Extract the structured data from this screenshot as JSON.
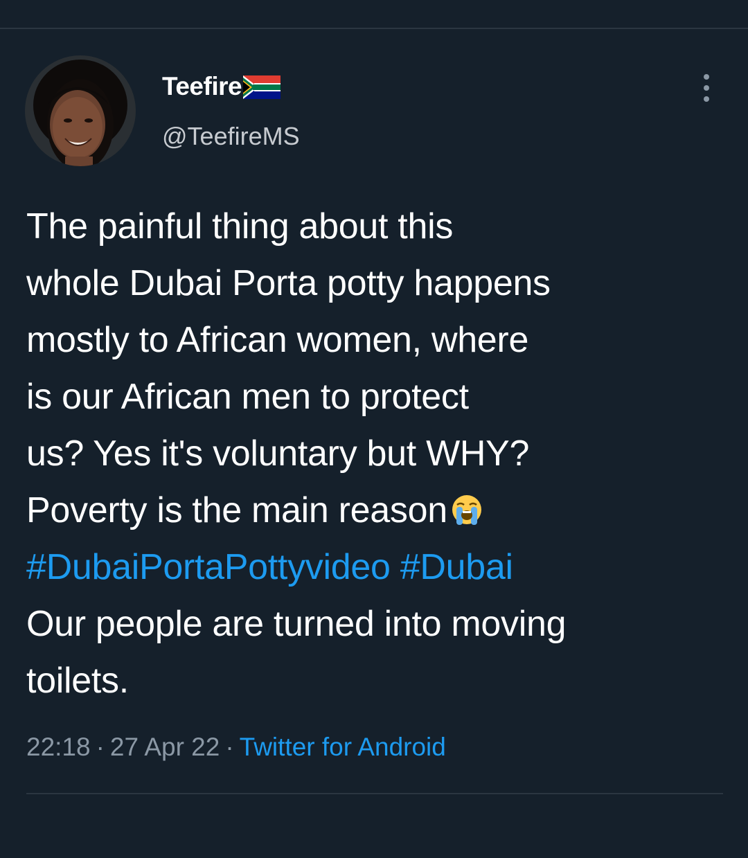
{
  "author": {
    "display_name": "Teefire",
    "handle": "@TeefireMS",
    "flag_icon": "south-africa-flag-icon",
    "avatar_icon": "user-avatar"
  },
  "tweet": {
    "lines": [
      "The painful thing about this",
      "whole Dubai Porta potty happens",
      "mostly to African women,  where",
      "is our African men to protect",
      "us? Yes it's voluntary but WHY?",
      "Poverty is the main reason"
    ],
    "emoji": "loudly-crying-face-icon",
    "hashtags": [
      "#DubaiPortaPottyvideo",
      "#Dubai"
    ],
    "after_hashtags_lines": [
      "Our people are turned into moving",
      "toilets."
    ]
  },
  "meta": {
    "time": "22:18",
    "separator": "·",
    "date": "27 Apr 22",
    "source": "Twitter for Android"
  },
  "menu": {
    "icon": "more-vertical-icon"
  },
  "colors": {
    "background": "#15202b",
    "text": "#ffffff",
    "secondary_text": "#8b98a5",
    "link": "#1d9bf0",
    "divider": "#2b3641"
  }
}
